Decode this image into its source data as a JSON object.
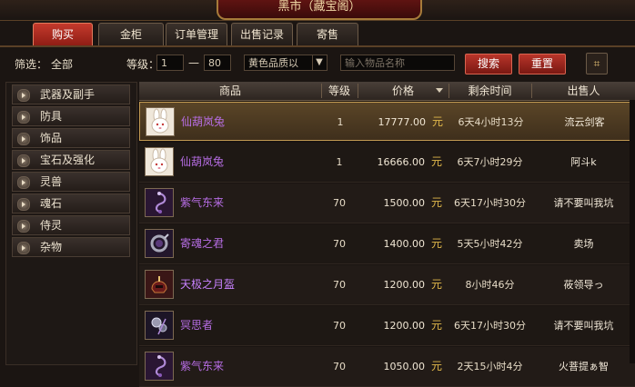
{
  "title": "黑市（藏宝阁）",
  "tabs": [
    {
      "label": "购买",
      "active": true
    },
    {
      "label": "金柜",
      "active": false
    },
    {
      "label": "订单管理",
      "active": false
    },
    {
      "label": "出售记录",
      "active": false
    },
    {
      "label": "寄售",
      "active": false
    }
  ],
  "filter": {
    "filter_label": "筛选：",
    "filter_value": "全部",
    "level_label": "等级：",
    "level_min": "1",
    "level_sep": "—",
    "level_max": "80",
    "quality_select": "黄色品质以",
    "search_placeholder": "输入物品名称",
    "search_button": "搜索",
    "reset_button": "重置"
  },
  "categories": [
    "武器及副手",
    "防具",
    "饰品",
    "宝石及强化",
    "灵兽",
    "魂石",
    "侍灵",
    "杂物"
  ],
  "table": {
    "columns": {
      "item": "商品",
      "level": "等级",
      "price": "价格",
      "time_left": "剩余时间",
      "seller": "出售人"
    },
    "currency_label": "元",
    "rows": [
      {
        "name": "仙葫岚兔",
        "level": "1",
        "price": "17777.00",
        "time": "6天4小时13分",
        "seller": "流云剑客",
        "icon": "rabbit-icon",
        "quality": "purple",
        "selected": true
      },
      {
        "name": "仙葫岚兔",
        "level": "1",
        "price": "16666.00",
        "time": "6天7小时29分",
        "seller": "阿斗k",
        "icon": "rabbit-icon",
        "quality": "purple",
        "selected": false
      },
      {
        "name": "紫气东来",
        "level": "70",
        "price": "1500.00",
        "time": "6天17小时30分",
        "seller": "请不要叫我坑",
        "icon": "swirl-charm-icon",
        "quality": "purple",
        "selected": false
      },
      {
        "name": "寄魂之君",
        "level": "70",
        "price": "1400.00",
        "time": "5天5小时42分",
        "seller": "卖场",
        "icon": "serpent-ring-icon",
        "quality": "purple",
        "selected": false
      },
      {
        "name": "天极之月盔",
        "level": "70",
        "price": "1200.00",
        "time": "8小时46分",
        "seller": "莜领导っ",
        "icon": "helmet-icon",
        "quality": "pink",
        "selected": false
      },
      {
        "name": "冥思者",
        "level": "70",
        "price": "1200.00",
        "time": "6天17小时30分",
        "seller": "请不要叫我坑",
        "icon": "orb-charm-icon",
        "quality": "purple",
        "selected": false
      },
      {
        "name": "紫气东来",
        "level": "70",
        "price": "1050.00",
        "time": "2天15小时4分",
        "seller": "火菩提ぁ智",
        "icon": "swirl-charm-icon",
        "quality": "purple",
        "selected": false
      }
    ]
  }
}
